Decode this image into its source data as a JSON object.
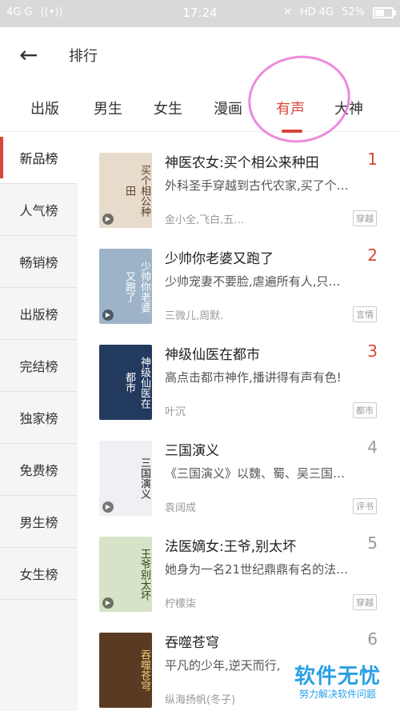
{
  "status_bar": {
    "left": "4G  G",
    "time": "17:24",
    "net": "HD 4G",
    "battery": "52%"
  },
  "header": {
    "title": "排行"
  },
  "tabs": [
    {
      "label": "出版"
    },
    {
      "label": "男生"
    },
    {
      "label": "女生"
    },
    {
      "label": "漫画"
    },
    {
      "label": "有声",
      "active": true
    },
    {
      "label": "大神"
    }
  ],
  "sidebar": {
    "items": [
      {
        "label": "新品榜",
        "active": true
      },
      {
        "label": "人气榜"
      },
      {
        "label": "畅销榜"
      },
      {
        "label": "出版榜"
      },
      {
        "label": "完结榜"
      },
      {
        "label": "独家榜"
      },
      {
        "label": "免费榜"
      },
      {
        "label": "男生榜"
      },
      {
        "label": "女生榜"
      }
    ]
  },
  "books": [
    {
      "rank": "1",
      "title": "神医农女:买个相公来种田",
      "desc": "外科圣手穿越到古代农家,买了个…",
      "author": "金小全,飞白,五…",
      "tag": "穿越",
      "cover_text": "买个相公种田",
      "cover_color": "#e7dccb",
      "rank_color": "#d9463a"
    },
    {
      "rank": "2",
      "title": "少帅你老婆又跑了",
      "desc": "少帅宠妻不要脸,虐遍所有人,只…",
      "author": "三微儿,周默.",
      "tag": "言情",
      "cover_text": "少帅你老婆又跑了",
      "cover_color": "#9db4c8",
      "rank_color": "#d9463a"
    },
    {
      "rank": "3",
      "title": "神级仙医在都市",
      "desc": "高点击都市神作,播讲得有声有色!",
      "author": "叶沉",
      "tag": "都市",
      "cover_text": "神级仙医在都市",
      "cover_color": "#223a5e",
      "rank_color": "#d9463a"
    },
    {
      "rank": "4",
      "title": "三国演义",
      "desc": "《三国演义》以魏、蜀、吴三国…",
      "author": "袁阔成",
      "tag": "评书",
      "cover_text": "三国演义",
      "cover_color": "#eef0f4",
      "rank_color": "#999999"
    },
    {
      "rank": "5",
      "title": "法医嫡女:王爷,别太坏",
      "desc": "她身为一名21世纪鼎鼎有名的法…",
      "author": "柠檬柒",
      "tag": "穿越",
      "cover_text": "王爷别太坏",
      "cover_color": "#d7e3c6",
      "rank_color": "#999999"
    },
    {
      "rank": "6",
      "title": "吞噬苍穹",
      "desc": "平凡的少年,逆天而行,",
      "author": "纵海扬帆(冬子)",
      "tag": "",
      "cover_text": "吞噬苍穹",
      "cover_color": "#5a3a22",
      "rank_color": "#999999"
    }
  ],
  "watermark": {
    "title": "软件无忧",
    "subtitle": "努力解决软件问题"
  }
}
